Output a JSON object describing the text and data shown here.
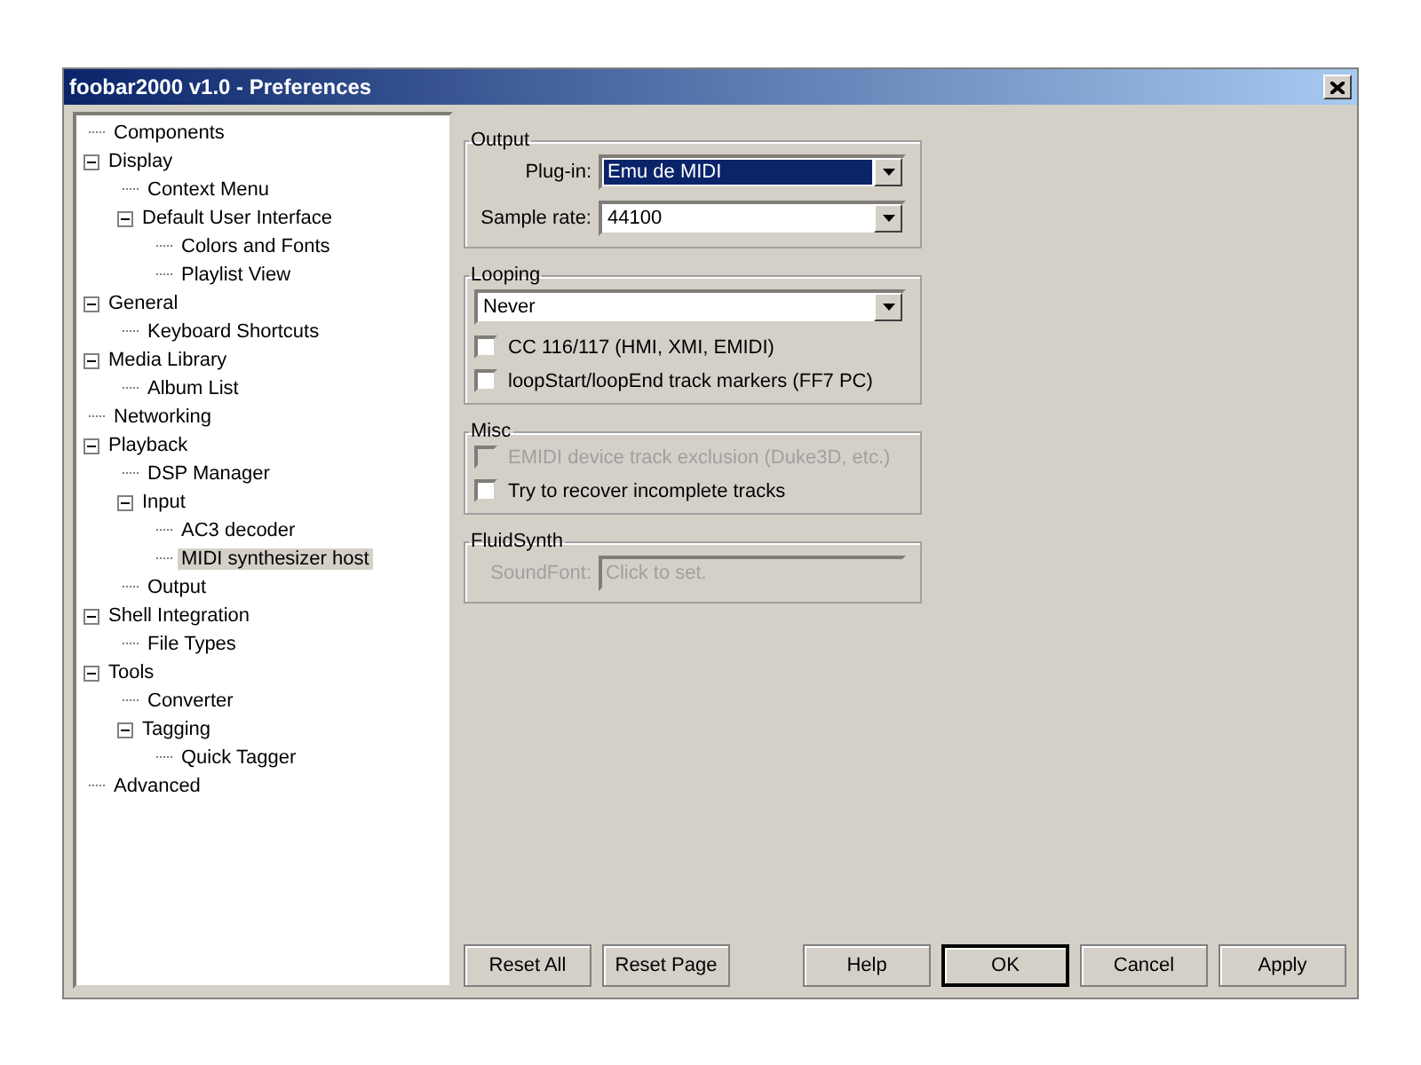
{
  "window": {
    "title": "foobar2000 v1.0 - Preferences"
  },
  "tree": [
    {
      "label": "Components"
    },
    {
      "label": "Display",
      "expanded": true,
      "children": [
        {
          "label": "Context Menu"
        },
        {
          "label": "Default User Interface",
          "expanded": true,
          "children": [
            {
              "label": "Colors and Fonts"
            },
            {
              "label": "Playlist View"
            }
          ]
        }
      ]
    },
    {
      "label": "General",
      "expanded": true,
      "children": [
        {
          "label": "Keyboard Shortcuts"
        }
      ]
    },
    {
      "label": "Media Library",
      "expanded": true,
      "children": [
        {
          "label": "Album List"
        }
      ]
    },
    {
      "label": "Networking"
    },
    {
      "label": "Playback",
      "expanded": true,
      "children": [
        {
          "label": "DSP Manager"
        },
        {
          "label": "Input",
          "expanded": true,
          "children": [
            {
              "label": "AC3 decoder"
            },
            {
              "label": "MIDI synthesizer host",
              "selected": true
            }
          ]
        },
        {
          "label": "Output"
        }
      ]
    },
    {
      "label": "Shell Integration",
      "expanded": true,
      "children": [
        {
          "label": "File Types"
        }
      ]
    },
    {
      "label": "Tools",
      "expanded": true,
      "children": [
        {
          "label": "Converter"
        },
        {
          "label": "Tagging",
          "expanded": true,
          "children": [
            {
              "label": "Quick Tagger"
            }
          ]
        }
      ]
    },
    {
      "label": "Advanced"
    }
  ],
  "groups": [
    {
      "title": "Output",
      "controls": [
        {
          "kind": "combo",
          "label": "Plug-in:",
          "value": "Emu de MIDI",
          "focused": true
        },
        {
          "kind": "combo",
          "label": "Sample rate:",
          "value": "44100",
          "focused": false
        }
      ]
    },
    {
      "title": "Looping",
      "controls": [
        {
          "kind": "combo",
          "value": "Never",
          "focused": false
        },
        {
          "kind": "checkbox",
          "label": "CC 116/117 (HMI, XMI, EMIDI)",
          "checked": false,
          "disabled": false
        },
        {
          "kind": "checkbox",
          "label": "loopStart/loopEnd track markers (FF7 PC)",
          "checked": false,
          "disabled": false
        }
      ]
    },
    {
      "title": "Misc",
      "controls": [
        {
          "kind": "checkbox",
          "label": "EMIDI device track exclusion (Duke3D, etc.)",
          "checked": false,
          "disabled": true
        },
        {
          "kind": "checkbox",
          "label": "Try to recover incomplete tracks",
          "checked": false,
          "disabled": false
        }
      ]
    },
    {
      "title": "FluidSynth",
      "controls": [
        {
          "kind": "text",
          "label": "SoundFont:",
          "placeholder": "Click to set.",
          "disabled": true
        }
      ]
    }
  ],
  "buttons": [
    {
      "label": "Reset All",
      "default": false
    },
    {
      "label": "Reset Page",
      "default": false
    },
    {
      "label": "Help",
      "default": false
    },
    {
      "label": "OK",
      "default": true
    },
    {
      "label": "Cancel",
      "default": false
    },
    {
      "label": "Apply",
      "default": false
    }
  ]
}
